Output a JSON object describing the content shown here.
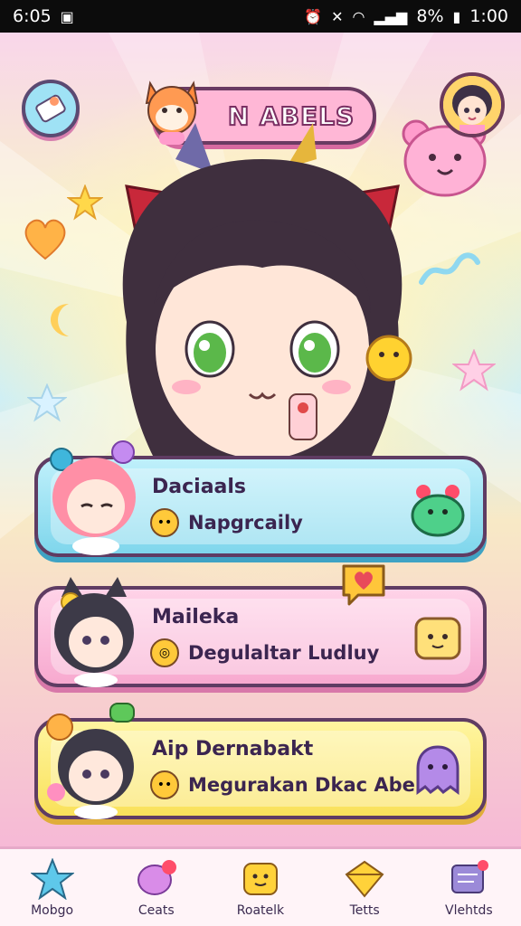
{
  "status_bar": {
    "time": "6:05",
    "battery_percent": "8%",
    "clock": "1:00"
  },
  "header": {
    "title": "N ABELS",
    "menu_icon": "book-icon",
    "profile_icon": "avatar-icon"
  },
  "cards": [
    {
      "title": "Daciaals",
      "subtitle": "Napgrcaily",
      "sub_icon": "face-icon",
      "deco": "green-monster-icon",
      "accent": "#7fd6ec"
    },
    {
      "title": "Maileka",
      "subtitle": "Degulaltar Ludluy",
      "sub_icon": "coin-icon",
      "deco": "toast-icon",
      "accent": "#f7a9cf"
    },
    {
      "title": "Aip Dernabakt",
      "subtitle": "Megurakan Dkac Abe",
      "sub_icon": "face-icon",
      "deco": "purple-ghost-icon",
      "accent": "#f9e15a"
    }
  ],
  "nav": [
    {
      "label": "Mobgo",
      "icon": "star-icon",
      "color": "#5ec8ea"
    },
    {
      "label": "Ceats",
      "icon": "chat-heart-icon",
      "color": "#d98ce8"
    },
    {
      "label": "Roatelk",
      "icon": "smile-box-icon",
      "color": "#ffd23a"
    },
    {
      "label": "Tetts",
      "icon": "gem-icon",
      "color": "#ffd23a"
    },
    {
      "label": "Vlehtds",
      "icon": "message-icon",
      "color": "#9b8ad8"
    }
  ]
}
